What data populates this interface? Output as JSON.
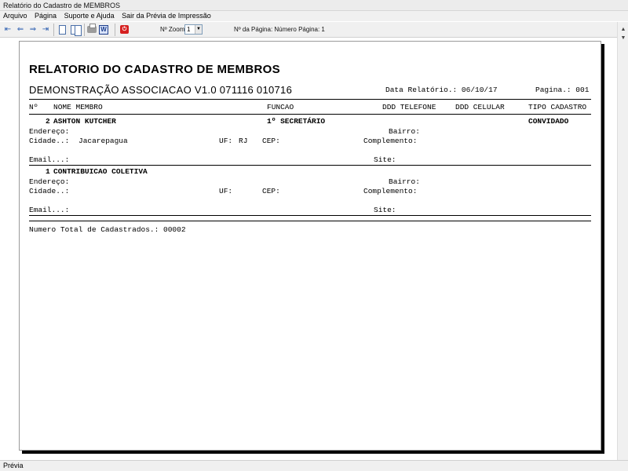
{
  "window": {
    "title": "Relatório do Cadastro de MEMBROS"
  },
  "menu": {
    "items": [
      "Arquivo",
      "Página",
      "Suporte e Ajuda",
      "Sair da Prévia de Impressão"
    ]
  },
  "toolbar": {
    "zoom_label": "Nº Zoom",
    "zoom_value": "1",
    "page_label": "Nº da Página: Número Página: 1",
    "nav_first_icon": "first-page-icon",
    "nav_prev_icon": "previous-page-icon",
    "nav_next_icon": "next-page-icon",
    "nav_last_icon": "last-page-icon",
    "print_icon": "printer-icon",
    "exit_icon": "exit-icon"
  },
  "report": {
    "title": "RELATORIO DO CADASTRO DE MEMBROS",
    "subtitle": "DEMONSTRAÇÃO ASSOCIACAO V1.0 071116 010716",
    "date_label": "Data Relatório.: 06/10/17",
    "page_label": "Pagina.: 001",
    "columns": {
      "num": "Nº",
      "name": "NOME MEMBRO",
      "role": "FUNCAO",
      "phone": "DDD TELEFONE",
      "mobile": "DDD CELULAR",
      "type": "TIPO CADASTRO"
    },
    "field_labels": {
      "address": "Endereço:",
      "district": "Bairro:",
      "city": "Cidade..:",
      "state": "UF:",
      "zip": "CEP:",
      "complement": "Complemento:",
      "email": "Email...:",
      "site": "Site:"
    },
    "records": [
      {
        "num": "2",
        "name": "ASHTON KUTCHER",
        "role": "1º SECRETÁRIO",
        "type": "CONVIDADO",
        "city": "Jacarepagua",
        "state": "RJ"
      },
      {
        "num": "1",
        "name": "CONTRIBUICAO COLETIVA",
        "role": "",
        "type": "",
        "city": "",
        "state": ""
      }
    ],
    "total_label": "Numero Total de Cadastrados.: 00002"
  },
  "status": {
    "text": "Prévia"
  },
  "colors": {
    "window_bg": "#f0f0f0",
    "page_bg": "#ffffff",
    "accent": "#2a5db0"
  }
}
